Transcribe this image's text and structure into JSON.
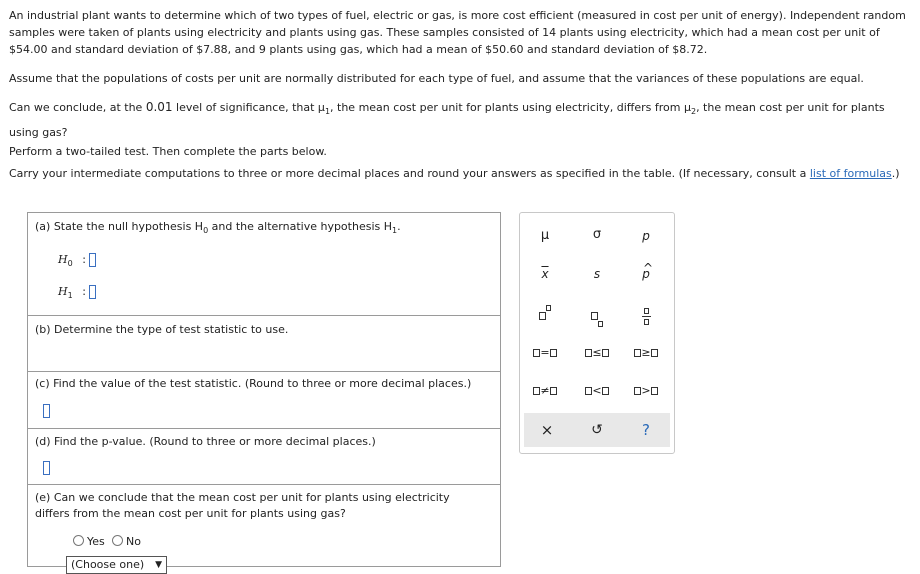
{
  "problem": {
    "p1": "An industrial plant wants to determine which of two types of fuel, electric or gas, is more cost efficient (measured in cost per unit of energy). Independent random samples were taken of plants using electricity and plants using gas. These samples consisted of 14 plants using electricity, which had a mean cost per unit of $54.00 and standard deviation of $7.88, and 9 plants using gas, which had a mean of $50.60 and standard deviation of $8.72.",
    "p2": "Assume that the populations of costs per unit are normally distributed for each type of fuel, and assume that the variances of these populations are equal.",
    "p3_a": "Can we conclude, at the ",
    "p3_alpha": "0.01",
    "p3_b": " level of significance, that μ",
    "p3_sub1": "1",
    "p3_c": ", the mean cost per unit for plants using electricity, differs from μ",
    "p3_sub2": "2",
    "p3_d": ", the mean cost per unit for plants using gas?",
    "p4": "Perform a two-tailed test. Then complete the parts below.",
    "p5": "Carry your intermediate computations to three or more decimal places and round your answers as specified in the table. (If necessary, consult a ",
    "p5_link": "list of formulas",
    "p5_end": ".)"
  },
  "parts": {
    "a_label": "(a) State the null hypothesis H",
    "a_sub0": "0",
    "a_mid": " and the alternative hypothesis H",
    "a_sub1": "1",
    "a_end": ".",
    "h0": "H",
    "h0_sub": "0",
    "h1": "H",
    "h1_sub": "1",
    "colon": ":",
    "b_label": "(b) Determine the type of test statistic to use.",
    "b_select": "(Choose one)",
    "c_label": "(c) Find the value of the test statistic. (Round to three or more decimal places.)",
    "d_label": "(d) Find the p-value. (Round to three or more decimal places.)",
    "e_line1": "(e) Can we conclude that the mean cost per unit for plants using electricity",
    "e_line2": "differs from the mean cost per unit for plants using gas?",
    "yes": "Yes",
    "no": "No"
  },
  "palette": {
    "mu": "μ",
    "sigma": "σ",
    "p": "p",
    "xbar": "x",
    "s": "s",
    "phat": "p",
    "eq": "=",
    "le": "≤",
    "ge": "≥",
    "ne": "≠",
    "lt": "<",
    "gt": ">",
    "clear": "×",
    "undo": "↺",
    "help": "?"
  },
  "colors": {
    "link": "#2a6ab8",
    "box": "#3a6fc0",
    "toolbar": "#e8e8e8"
  }
}
